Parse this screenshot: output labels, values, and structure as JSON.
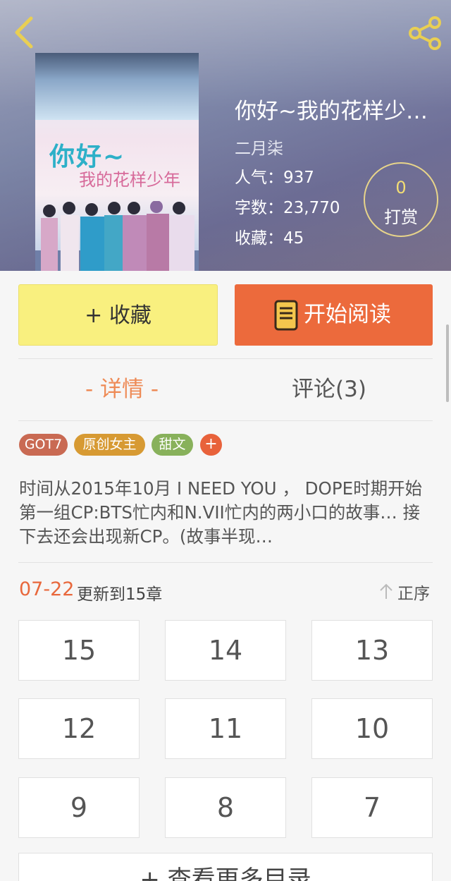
{
  "header": {
    "title": "你好~我的花样少…",
    "author": "二月柒",
    "popularity": "人气：937",
    "word_count": "字数：23,770",
    "favorites": "收藏：45",
    "tip_count": "0",
    "tip_label": "打赏",
    "cover_title_line1": "你好~",
    "cover_title_line2": "我的花样少年"
  },
  "actions": {
    "favorite_label": "+ 收藏",
    "read_label": "开始阅读"
  },
  "tabs": {
    "details": "- 详情 -",
    "comments": "评论(3)"
  },
  "tags": [
    "GOT7",
    "原创女主",
    "甜文"
  ],
  "tag_add": "+",
  "synopsis": "时间从2015年10月 I NEED YOU ， DOPE时期开始 第一组CP:BTS忙内和N.VII忙内的两小口的故事… 接下去还会出现新CP。(故事半现…",
  "update": {
    "date": "07-22",
    "text": "更新到15章",
    "sort_label": "正序"
  },
  "chapters": [
    "15",
    "14",
    "13",
    "12",
    "11",
    "10",
    "9",
    "8",
    "7"
  ],
  "more_label": "+ 查看更多目录",
  "colors": {
    "accent_orange": "#ec6a3c",
    "favorite_yellow": "#f9f07f",
    "tab_active": "#ee8a55"
  },
  "icons": {
    "back": "chevron-left-icon",
    "share": "share-icon",
    "read": "book-icon",
    "sort": "arrow-up-icon"
  }
}
